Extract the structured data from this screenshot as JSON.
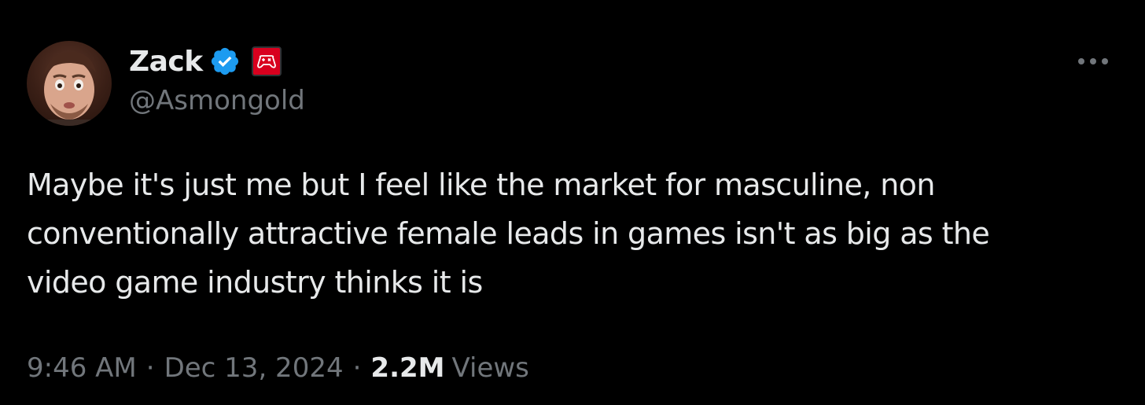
{
  "author": {
    "display_name": "Zack",
    "handle": "@Asmongold",
    "verified_color": "#1d9bf0",
    "affiliate_badge_color": "#d8001e",
    "affiliate_badge_icon": "gamepad-icon"
  },
  "tweet": {
    "lines": [
      "Maybe it's just me but I feel like the market for masculine, non",
      "conventionally attractive female leads in games isn't as big as the",
      "video game industry thinks it is"
    ]
  },
  "meta": {
    "time": "9:46 AM",
    "separator": "·",
    "date": "Dec 13, 2024",
    "views_count": "2.2M",
    "views_label": "Views"
  },
  "colors": {
    "background": "#000000",
    "primary_text": "#e7e9ea",
    "secondary_text": "#71767b"
  }
}
